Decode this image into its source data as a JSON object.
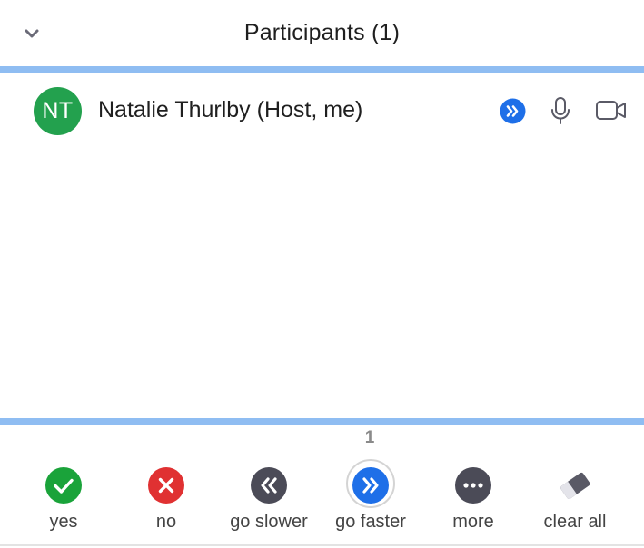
{
  "header": {
    "title": "Participants (1)",
    "collapse_icon": "chevron-down-icon"
  },
  "participants": [
    {
      "initials": "NT",
      "name": "Natalie Thurlby (Host, me)",
      "avatar_color": "#23a14e",
      "status_icon": "go-faster-icon",
      "mic_icon": "microphone-icon",
      "video_icon": "video-camera-icon"
    }
  ],
  "feedback": {
    "faster_count": "1",
    "items": [
      {
        "label": "yes",
        "icon": "check-icon",
        "color": "#1aa33a"
      },
      {
        "label": "no",
        "icon": "close-icon",
        "color": "#e03132"
      },
      {
        "label": "go slower",
        "icon": "go-slower-icon",
        "color": "#4b4b57"
      },
      {
        "label": "go faster",
        "icon": "go-faster-icon",
        "color": "#1e6fe8",
        "selected": true
      },
      {
        "label": "more",
        "icon": "more-icon",
        "color": "#4b4b57"
      },
      {
        "label": "clear all",
        "icon": "eraser-icon",
        "color": "#5a5a66"
      }
    ]
  },
  "colors": {
    "divider": "#8fbdf2",
    "accent_blue": "#1e6fe8"
  }
}
